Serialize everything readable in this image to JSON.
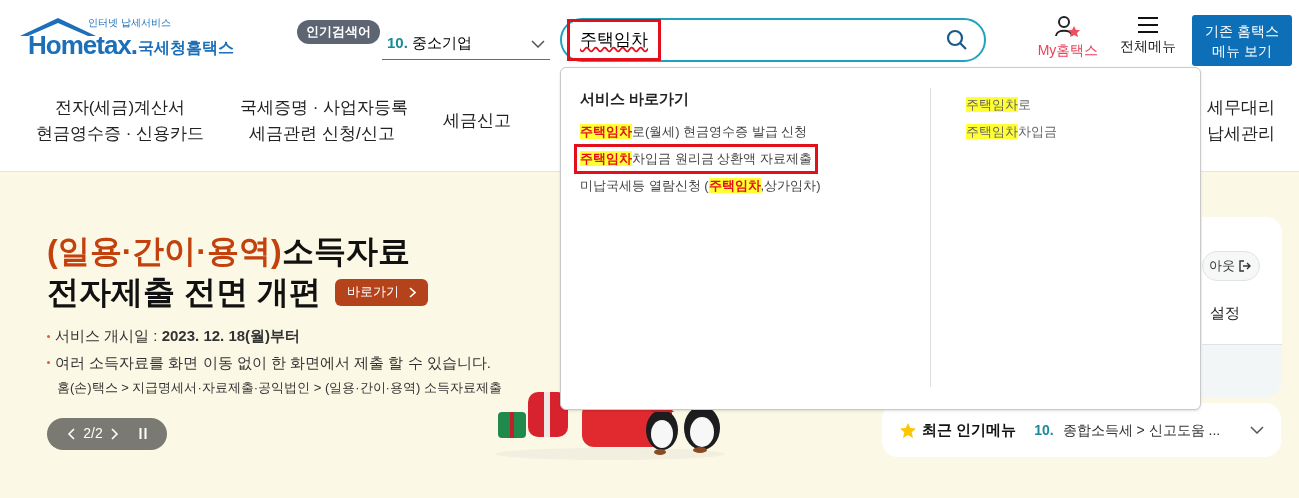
{
  "logo": {
    "tagline": "인터넷 납세서비스",
    "wordmark": "Hometax.",
    "name": "국세청홈택스"
  },
  "popular_search": {
    "badge": "인기검색어",
    "rank": "10.",
    "term": "중소기업"
  },
  "search": {
    "value": "주택임차",
    "annotated": true
  },
  "header_links": [
    {
      "kind": "my",
      "label": "My홈택스"
    },
    {
      "kind": "menu",
      "label": "전체메뉴"
    }
  ],
  "legacy_button": [
    "기존 홈택스",
    "메뉴 보기"
  ],
  "nav": [
    {
      "lines": [
        "전자(세금)계산서",
        "현금영수증 · 신용카드"
      ]
    },
    {
      "lines": [
        "국세증명 · 사업자등록",
        "세금관련 신청/신고"
      ]
    },
    {
      "lines": [
        "세금신고"
      ]
    },
    {
      "lines": [
        "세무대리",
        "납세관리"
      ]
    }
  ],
  "banner": {
    "title": [
      {
        "text": "(일용·간이·용역)",
        "accent": true
      },
      {
        "text": "소득자료",
        "accent": false
      }
    ],
    "subtitle": "전자제출 전면 개편",
    "go_button": "바로가기",
    "bullets": [
      "서비스 개시일 : **2023. 12. 18(월)부터**",
      "여러 소득자료를 화면 이동 없이 한 화면에서 제출 할 수 있습니다."
    ],
    "path": "홈(손)택스 > 지급명세서·자료제출·공익법인 > (일용·간이·용역) 소득자료제출",
    "pager": "2/2"
  },
  "dropdown": {
    "heading": "서비스 바로가기",
    "services": [
      {
        "annotated": false,
        "segments": [
          {
            "text": "주택임차",
            "match": true
          },
          {
            "text": "로(월세) 현금영수증 발급 신청",
            "match": false
          }
        ]
      },
      {
        "annotated": true,
        "segments": [
          {
            "text": "주택임차",
            "match": true
          },
          {
            "text": "차입금 원리금 상환액 자료제출",
            "match": false
          }
        ]
      },
      {
        "annotated": false,
        "segments": [
          {
            "text": "미납국세등 열람신청 (",
            "match": false
          },
          {
            "text": "주택임차",
            "match": true
          },
          {
            "text": ",상가임차)",
            "match": false
          }
        ]
      }
    ],
    "keywords": [
      {
        "segments": [
          {
            "text": "주택임차",
            "match": true
          },
          {
            "text": "로",
            "match": false
          }
        ]
      },
      {
        "segments": [
          {
            "text": "주택임차",
            "match": true
          },
          {
            "text": "차입금",
            "match": false
          }
        ]
      }
    ]
  },
  "login_card": {
    "logout": "아웃",
    "setting": "설정"
  },
  "recent": {
    "title": "최근 인기메뉴",
    "rank": "10.",
    "path": "종합소득세 > 신고도움 ..."
  }
}
